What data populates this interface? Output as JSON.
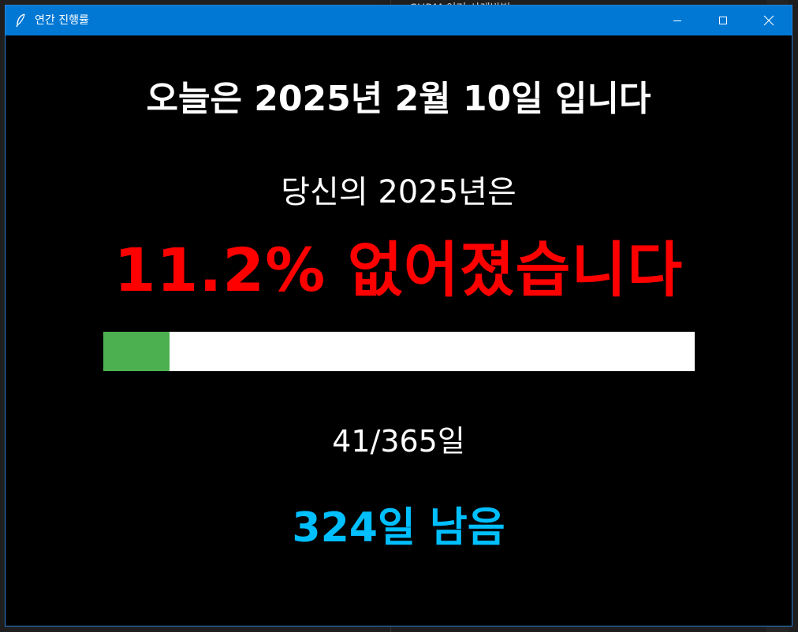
{
  "window": {
    "title": "연간 진행률",
    "icon": "feather-icon"
  },
  "background": {
    "editor_text": "SHRM 이거 사례방법"
  },
  "content": {
    "date_line": "오늘은 2025년 2월 10일 입니다",
    "sub_line": "당신의 2025년은",
    "lost_line": "11.2% 없어졌습니다",
    "progress_fraction": 0.112,
    "days_line": "41/365일",
    "remaining_line": "324일 남음"
  },
  "colors": {
    "titlebar": "#0078d4",
    "lost_text": "#ff0000",
    "remaining_text": "#00bfff",
    "progress_fill": "#4caf50",
    "progress_track": "#ffffff"
  }
}
